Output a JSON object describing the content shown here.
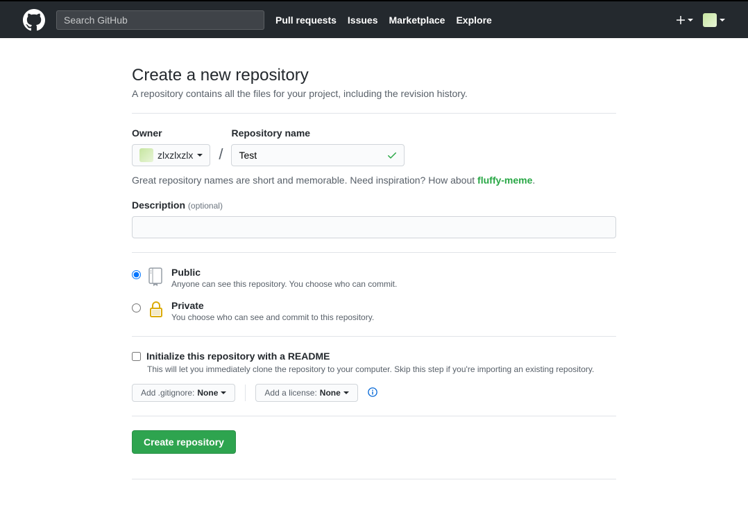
{
  "header": {
    "search_placeholder": "Search GitHub",
    "nav": {
      "pull_requests": "Pull requests",
      "issues": "Issues",
      "marketplace": "Marketplace",
      "explore": "Explore"
    }
  },
  "page": {
    "title": "Create a new repository",
    "subtitle": "A repository contains all the files for your project, including the revision history."
  },
  "form": {
    "owner_label": "Owner",
    "owner_value": "zlxzlxzlx",
    "repo_name_label": "Repository name",
    "repo_name_value": "Test",
    "help_text_prefix": "Great repository names are short and memorable. Need inspiration? How about ",
    "suggestion": "fluffy-meme",
    "help_text_suffix": ".",
    "description_label": "Description",
    "description_optional": "(optional)",
    "description_value": ""
  },
  "visibility": {
    "public": {
      "title": "Public",
      "desc": "Anyone can see this repository. You choose who can commit."
    },
    "private": {
      "title": "Private",
      "desc": "You choose who can see and commit to this repository."
    }
  },
  "readme": {
    "title": "Initialize this repository with a README",
    "desc": "This will let you immediately clone the repository to your computer. Skip this step if you're importing an existing repository."
  },
  "dropdowns": {
    "gitignore_prefix": "Add .gitignore:",
    "gitignore_value": "None",
    "license_prefix": "Add a license:",
    "license_value": "None"
  },
  "submit_label": "Create repository"
}
